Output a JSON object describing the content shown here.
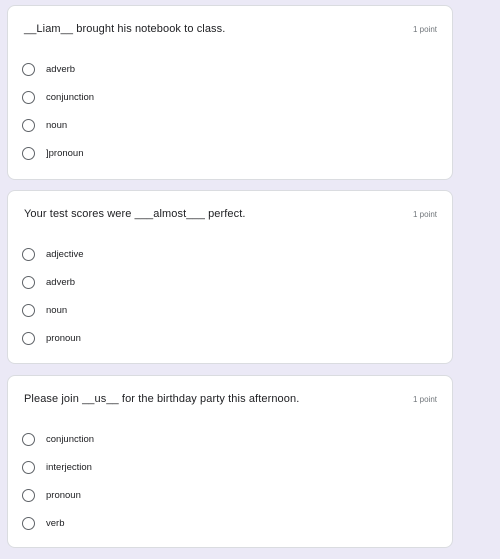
{
  "questions": [
    {
      "title": "__Liam__ brought his notebook to class.",
      "points": "1 point",
      "options": [
        "adverb",
        "conjunction",
        "noun",
        "]pronoun"
      ]
    },
    {
      "title": "Your test scores were ___almost___ perfect.",
      "points": "1 point",
      "options": [
        "adjective",
        "adverb",
        "noun",
        "pronoun"
      ]
    },
    {
      "title": "Please join __us__ for the birthday party this afternoon.",
      "points": "1 point",
      "options": [
        "conjunction",
        "interjection",
        "pronoun",
        "verb"
      ]
    }
  ]
}
